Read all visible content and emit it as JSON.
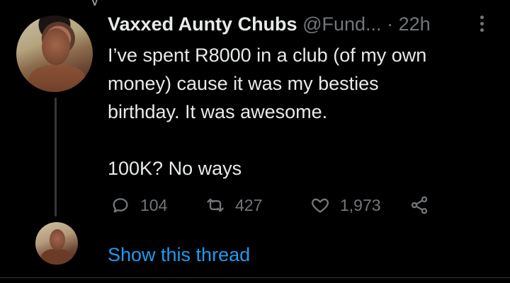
{
  "previous_tweet": {
    "fragment": "_y_"
  },
  "tweet": {
    "display_name": "Vaxxed Aunty Chubs",
    "handle": "@Fund...",
    "separator": "·",
    "time": "22h",
    "body_lines": [
      "I’ve spent R8000 in a club (of my own",
      "money) cause it was my besties",
      "birthday. It was awesome.",
      "100K? No ways"
    ],
    "actions": {
      "reply_count": "104",
      "retweet_count": "427",
      "like_count": "1,973"
    },
    "show_thread_label": "Show this thread"
  },
  "icons": {
    "more": "more-options-icon",
    "reply": "reply-icon",
    "retweet": "retweet-icon",
    "like": "heart-icon",
    "share": "share-icon"
  },
  "colors": {
    "background": "#000000",
    "text": "#e7e9ea",
    "muted": "#71767b",
    "link": "#1d9bf0"
  }
}
